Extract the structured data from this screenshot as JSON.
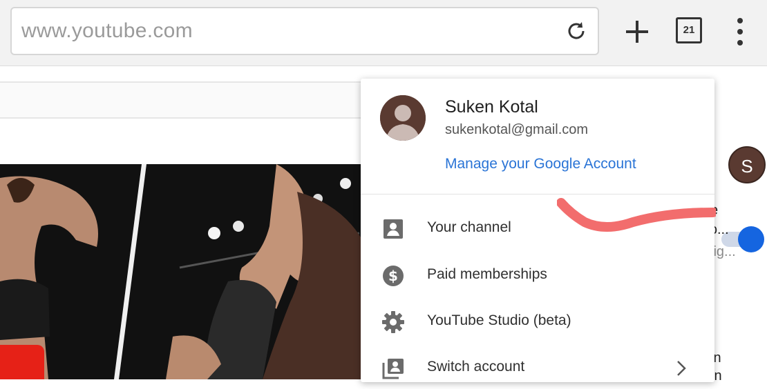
{
  "browser": {
    "url": "www.youtube.com",
    "tab_count": "21",
    "icons": [
      "reload-icon",
      "plus-icon",
      "tabs-icon",
      "more-vert-icon"
    ]
  },
  "header": {
    "avatar_letter": "S"
  },
  "account_menu": {
    "name": "Suken Kotal",
    "email": "sukenkotal@gmail.com",
    "manage_link": "Manage your Google Account",
    "items": [
      {
        "label": "Your channel",
        "icon": "person-box-icon"
      },
      {
        "label": "Paid memberships",
        "icon": "dollar-circle-icon"
      },
      {
        "label": "YouTube Studio (beta)",
        "icon": "gear-icon"
      },
      {
        "label": "Switch account",
        "icon": "switch-account-icon"
      }
    ]
  },
  "side_snippets": [
    "e",
    "ɔ...",
    "lig...",
    "in",
    "ın"
  ],
  "colors": {
    "link": "#2a74d6",
    "toggle_on": "#1565e0",
    "annotation": "#f26d6d",
    "youtube_red": "#e62117"
  }
}
